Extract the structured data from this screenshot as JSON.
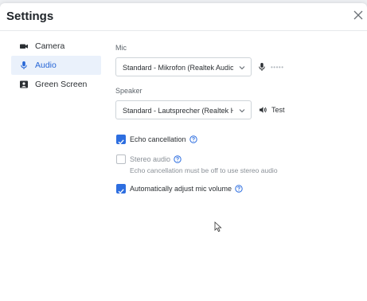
{
  "header": {
    "title": "Settings"
  },
  "sidebar": {
    "items": [
      {
        "label": "Camera",
        "icon": "camera-icon"
      },
      {
        "label": "Audio",
        "icon": "mic-icon",
        "active": true
      },
      {
        "label": "Green Screen",
        "icon": "green-screen-icon"
      }
    ]
  },
  "audio": {
    "mic": {
      "label": "Mic",
      "value": "Standard - Mikrofon (Realtek Audio US",
      "level_indicator": "•••••"
    },
    "speaker": {
      "label": "Speaker",
      "value": "Standard - Lautsprecher (Realtek High",
      "test_label": "Test"
    },
    "options": [
      {
        "label": "Echo cancellation",
        "checked": true,
        "has_help": true
      },
      {
        "label": "Stereo audio",
        "checked": false,
        "disabled": true,
        "has_help": true,
        "hint": "Echo cancellation must be off to use stereo audio"
      },
      {
        "label": "Automatically adjust mic volume",
        "checked": true,
        "has_help": true
      }
    ]
  },
  "colors": {
    "accent": "#2d6ee0",
    "active_bg": "#eaf1fb",
    "active_text": "#2666d6"
  }
}
